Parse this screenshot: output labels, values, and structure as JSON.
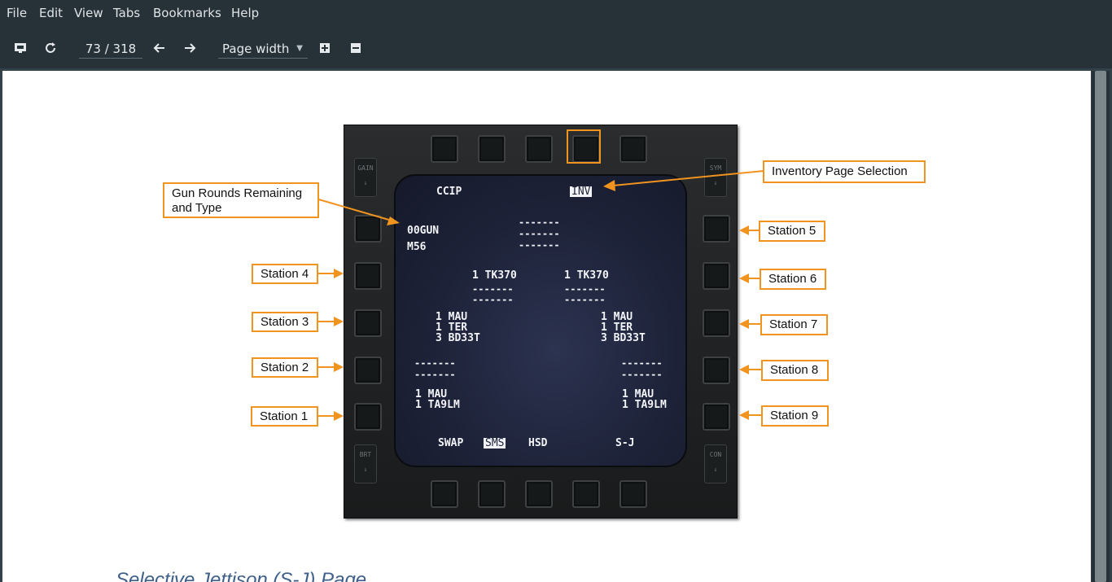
{
  "menu": [
    "File",
    "Edit",
    "View",
    "Tabs",
    "Bookmarks",
    "Help"
  ],
  "toolbar": {
    "page_indicator": "73 / 318",
    "zoom": "Page width",
    "icons": [
      "present-icon",
      "reload-icon",
      "back-arrow-icon",
      "forward-arrow-icon",
      "zoom-dropdown-chevron-icon",
      "zoom-in-icon",
      "zoom-out-icon"
    ]
  },
  "mfd": {
    "rocker_labels": {
      "gain": "GAIN",
      "sym": "SYM",
      "brt": "BRT",
      "con": "CON"
    },
    "top_left": "CCIP",
    "top_right_highlight": "INV",
    "gun_rounds": "00GUN",
    "gun_type": "M56",
    "right_dashes": [
      "-------",
      "-------",
      "-------"
    ],
    "tank_left": "1 TK370",
    "tank_right": "1 TK370",
    "tank_dashes": "-------",
    "st3": [
      "1 MAU",
      "1 TER",
      "3 BD33T"
    ],
    "st7": [
      "1 MAU",
      "1 TER",
      "3 BD33T"
    ],
    "st2_dashes": [
      "-------",
      "-------"
    ],
    "st8_dashes": [
      "-------",
      "-------"
    ],
    "st1": [
      "1 MAU",
      "1 TA9LM"
    ],
    "st9": [
      "1 MAU",
      "1 TA9LM"
    ],
    "bottom": {
      "swap": "SWAP",
      "sms": "SMS",
      "hsd": "HSD",
      "sj": "S-J"
    }
  },
  "callouts": {
    "gun_rounds": [
      "Gun Rounds Remaining",
      "and Type"
    ],
    "inventory": "Inventory Page Selection",
    "station1": "Station 1",
    "station2": "Station 2",
    "station3": "Station 3",
    "station4": "Station 4",
    "station5": "Station 5",
    "station6": "Station 6",
    "station7": "Station 7",
    "station8": "Station 8",
    "station9": "Station 9"
  },
  "colors": {
    "callout_orange": "#f0931f",
    "heading_blue": "#3e5f8a"
  },
  "footer_heading": "Selective Jettison (S-J) Page"
}
